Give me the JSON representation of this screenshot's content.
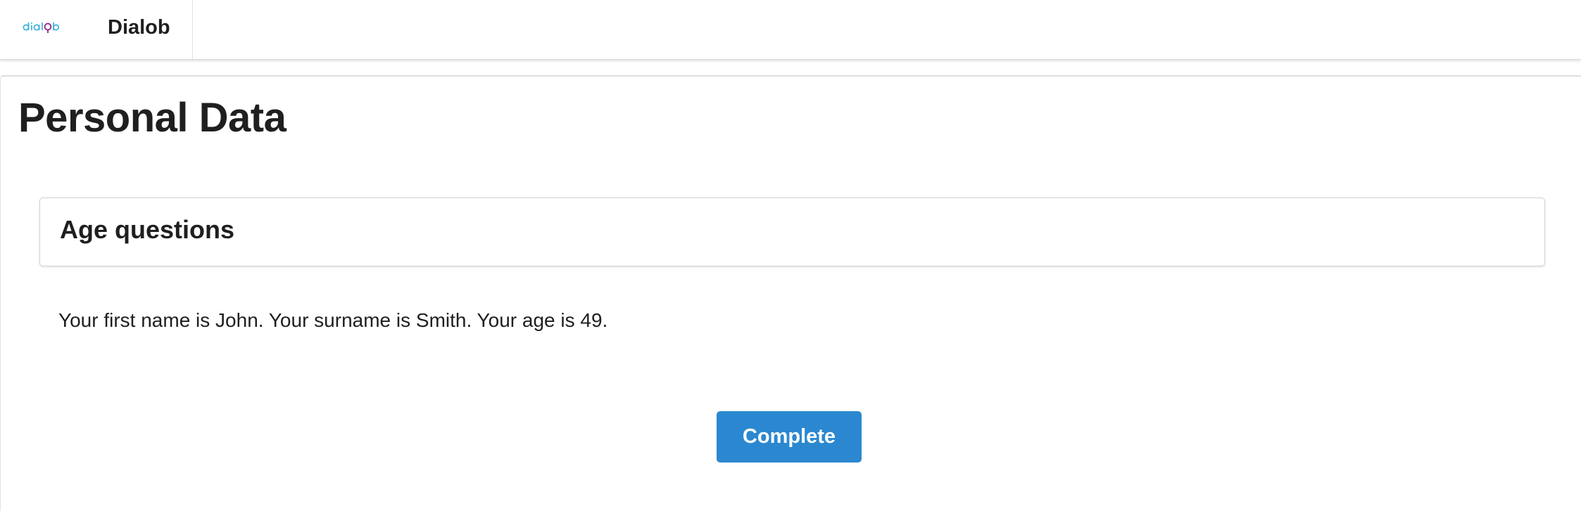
{
  "header": {
    "logo_text": "dialob",
    "app_name": "Dialob"
  },
  "page": {
    "title": "Personal Data"
  },
  "group": {
    "title": "Age questions"
  },
  "note": {
    "text": "Your first name is John. Your surname is Smith. Your age is 49."
  },
  "actions": {
    "complete_label": "Complete"
  },
  "colors": {
    "logo_blue": "#3ab0dd",
    "logo_magenta": "#9a2d8c",
    "button_blue": "#2b88d0"
  }
}
